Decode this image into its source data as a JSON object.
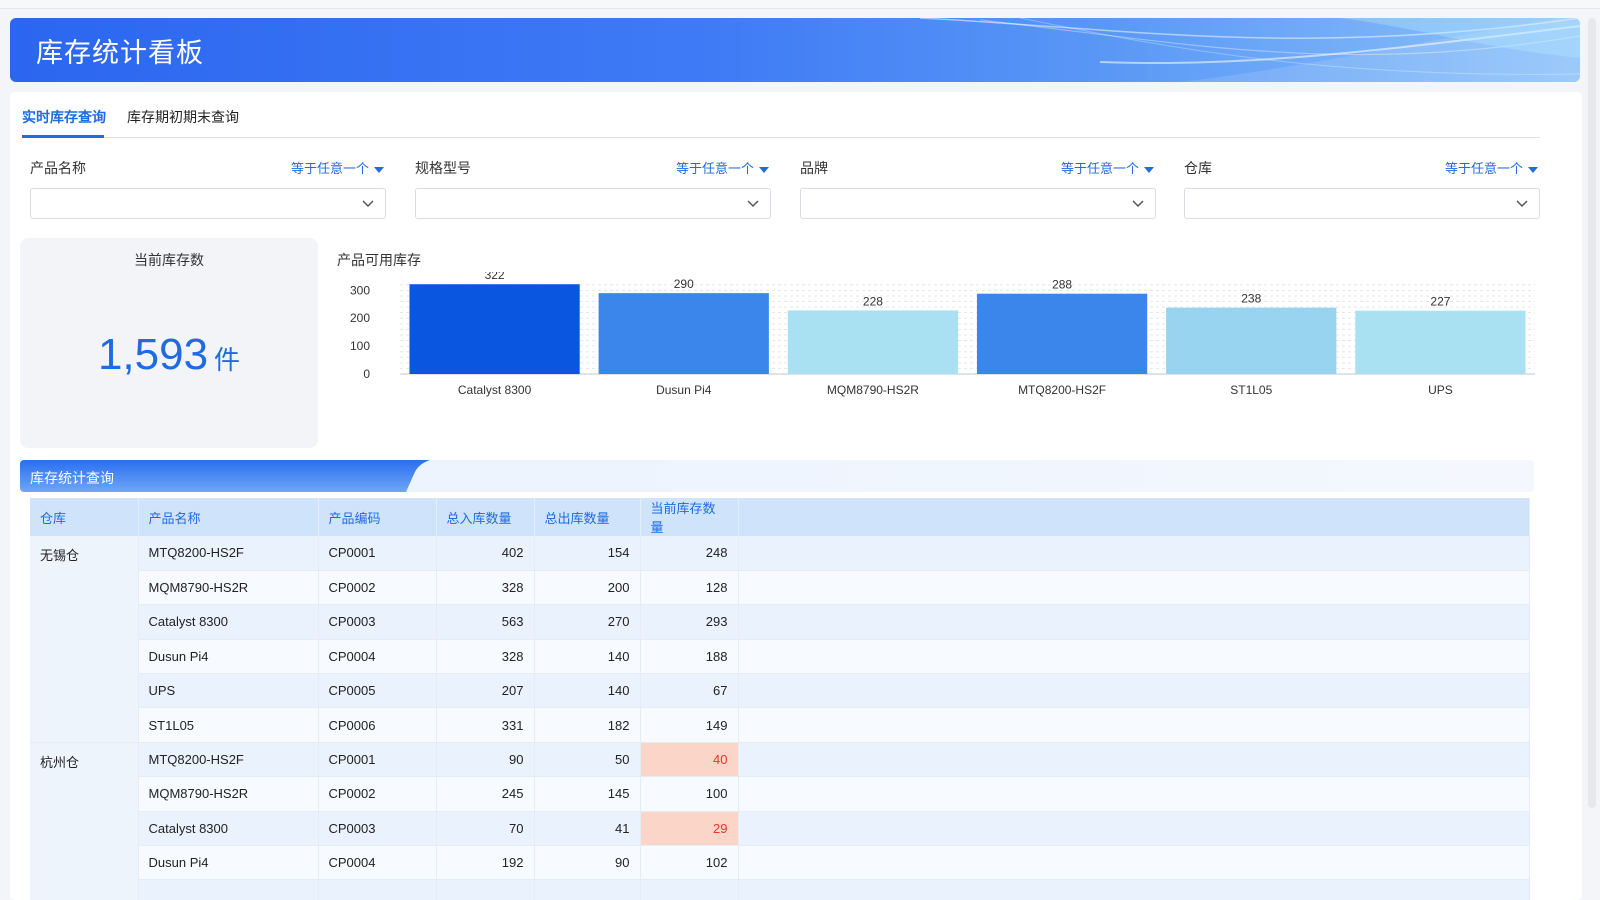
{
  "header": {
    "title": "库存统计看板"
  },
  "tabs": [
    {
      "label": "实时库存查询",
      "active": true
    },
    {
      "label": "库存期初期末查询",
      "active": false
    }
  ],
  "filters": [
    {
      "label": "产品名称",
      "operator": "等于任意一个",
      "value": ""
    },
    {
      "label": "规格型号",
      "operator": "等于任意一个",
      "value": ""
    },
    {
      "label": "品牌",
      "operator": "等于任意一个",
      "value": ""
    },
    {
      "label": "仓库",
      "operator": "等于任意一个",
      "value": ""
    }
  ],
  "kpi": {
    "title": "当前库存数",
    "value": "1,593",
    "unit": "件"
  },
  "chart_data": {
    "type": "bar",
    "title": "产品可用库存",
    "categories": [
      "Catalyst 8300",
      "Dusun Pi4",
      "MQM8790-HS2R",
      "MTQ8200-HS2F",
      "ST1L05",
      "UPS"
    ],
    "values": [
      322,
      290,
      228,
      288,
      238,
      227
    ],
    "colors": [
      "#0a56e0",
      "#3a86ea",
      "#a9e1f2",
      "#3a86ea",
      "#98d3f0",
      "#a9e1f2"
    ],
    "yticks": [
      0,
      100,
      200,
      300
    ],
    "ylim": [
      0,
      330
    ],
    "grid": true
  },
  "section": {
    "title": "库存统计查询"
  },
  "table": {
    "columns": [
      "仓库",
      "产品名称",
      "产品编码",
      "总入库数量",
      "总出库数量",
      "当前库存数量"
    ],
    "rows": [
      {
        "warehouse": "无锡仓",
        "name": "MTQ8200-HS2F",
        "code": "CP0001",
        "in": "402",
        "out": "154",
        "stock": "248",
        "low": false
      },
      {
        "warehouse": "",
        "name": "MQM8790-HS2R",
        "code": "CP0002",
        "in": "328",
        "out": "200",
        "stock": "128",
        "low": false
      },
      {
        "warehouse": "",
        "name": "Catalyst 8300",
        "code": "CP0003",
        "in": "563",
        "out": "270",
        "stock": "293",
        "low": false
      },
      {
        "warehouse": "",
        "name": "Dusun Pi4",
        "code": "CP0004",
        "in": "328",
        "out": "140",
        "stock": "188",
        "low": false
      },
      {
        "warehouse": "",
        "name": "UPS",
        "code": "CP0005",
        "in": "207",
        "out": "140",
        "stock": "67",
        "low": false
      },
      {
        "warehouse": "",
        "name": "ST1L05",
        "code": "CP0006",
        "in": "331",
        "out": "182",
        "stock": "149",
        "low": false
      },
      {
        "warehouse": "杭州仓",
        "name": "MTQ8200-HS2F",
        "code": "CP0001",
        "in": "90",
        "out": "50",
        "stock": "40",
        "low": true
      },
      {
        "warehouse": "",
        "name": "MQM8790-HS2R",
        "code": "CP0002",
        "in": "245",
        "out": "145",
        "stock": "100",
        "low": false
      },
      {
        "warehouse": "",
        "name": "Catalyst 8300",
        "code": "CP0003",
        "in": "70",
        "out": "41",
        "stock": "29",
        "low": true
      },
      {
        "warehouse": "",
        "name": "Dusun Pi4",
        "code": "CP0004",
        "in": "192",
        "out": "90",
        "stock": "102",
        "low": false
      },
      {
        "warehouse": "",
        "name": "",
        "code": "",
        "in": "",
        "out": "",
        "stock": "",
        "low": false
      }
    ]
  }
}
